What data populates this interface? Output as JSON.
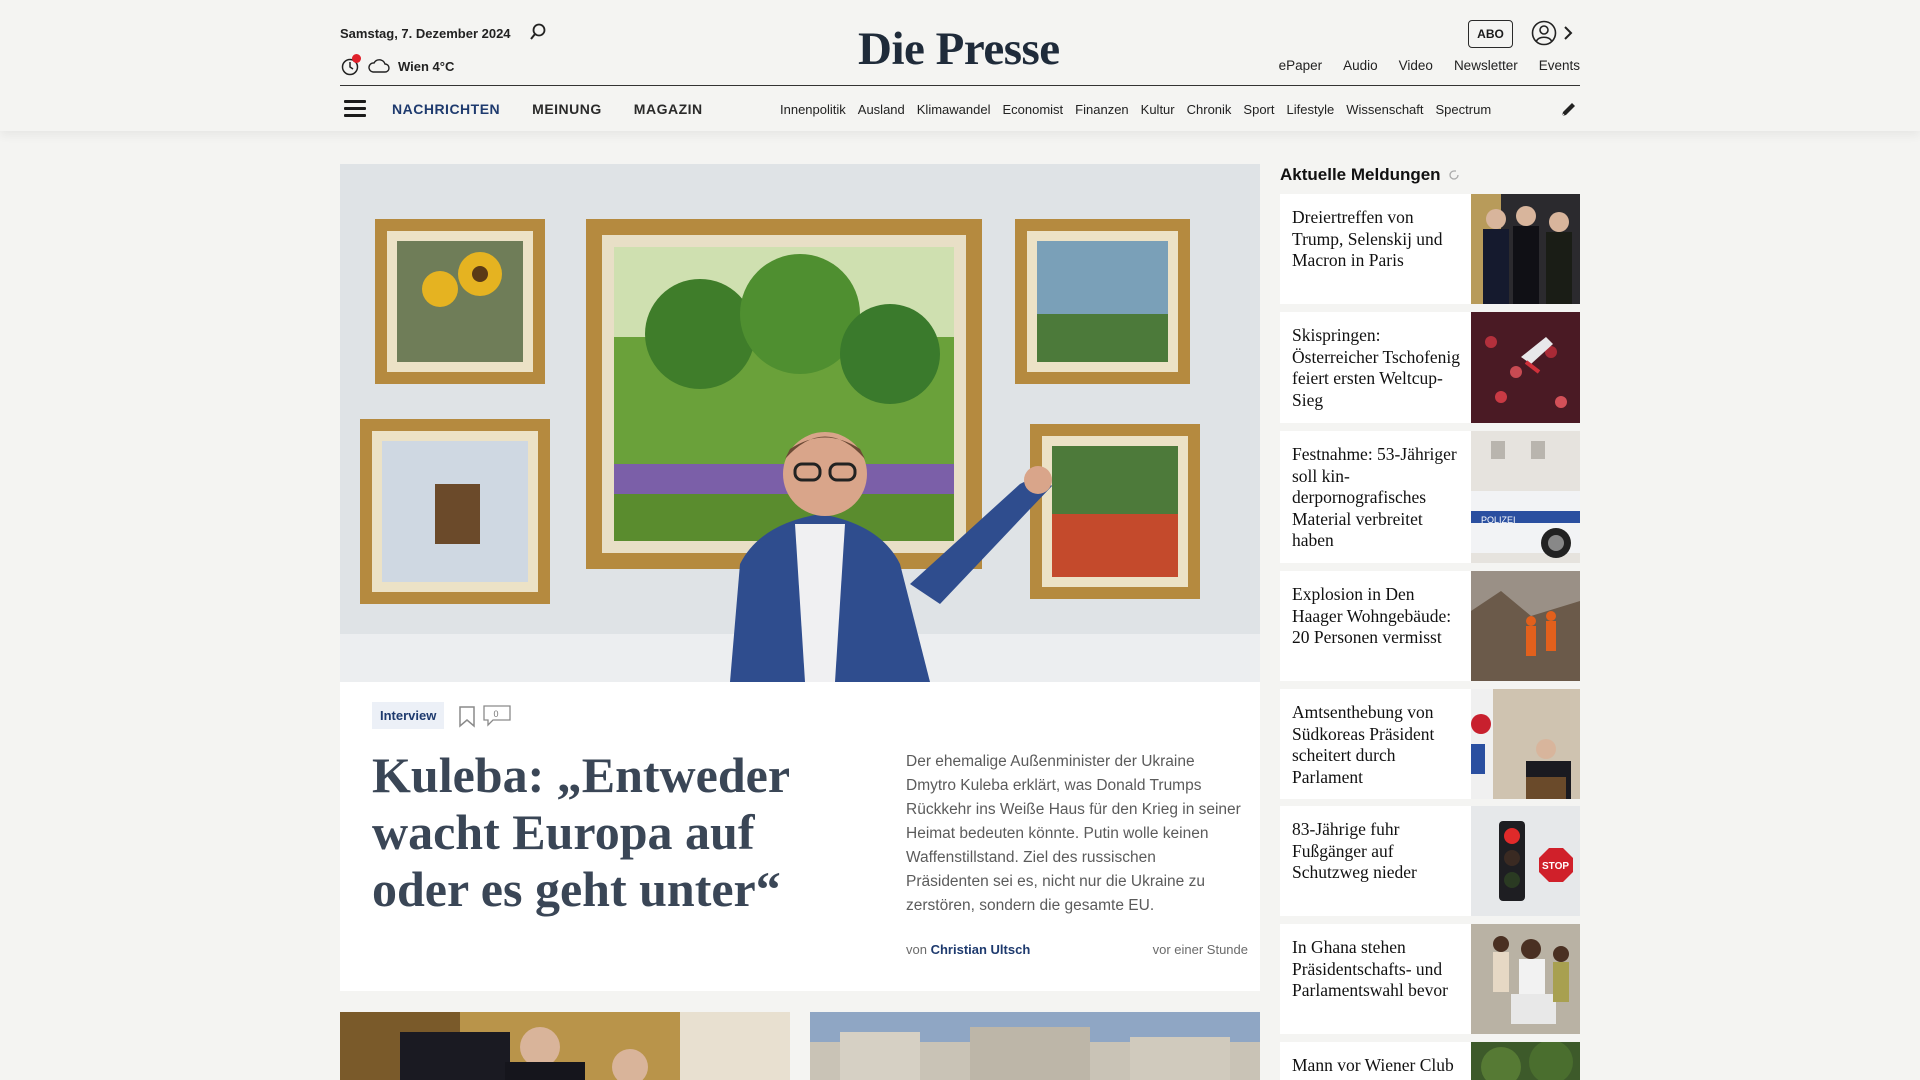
{
  "header": {
    "date": "Samstag, 7. Dezember 2024",
    "weather": "Wien 4°C",
    "logo": "Die Presse",
    "abo_label": "ABO",
    "top_links": [
      "ePaper",
      "Audio",
      "Video",
      "Newsletter",
      "Events"
    ],
    "main_nav": [
      "NACHRICHTEN",
      "MEINUNG",
      "MAGAZIN"
    ],
    "sub_nav": [
      "Innenpolitik",
      "Ausland",
      "Klimawandel",
      "Economist",
      "Finanzen",
      "Kultur",
      "Chronik",
      "Sport",
      "Lifestyle",
      "Wissenschaft",
      "Spectrum"
    ]
  },
  "hero": {
    "tag": "Interview",
    "comment_count": "0",
    "headline": "Kuleba: „Entweder wacht Europa auf oder es geht unter“",
    "teaser": "Der ehemalige Außenminister der Ukraine Dmytro Kuleba erklärt, was Donald Trumps Rückkehr ins Weiße Haus für den Krieg in seiner Heimat bedeuten könnte. Putin wolle keinen Waffenstillstand. Ziel des russischen Präsidenten sei es, nicht nur die Ukraine zu zerstören, sondern die gesamte EU.",
    "byline_prefix": "von",
    "author": "Christian Ultsch",
    "time_ago": "vor einer Stunde"
  },
  "sidebar": {
    "title": "Aktuelle Meldungen",
    "items": [
      {
        "title": "Dreiertreffen von Trump, Selenskij und Macron in Paris"
      },
      {
        "title": "Skispringen: Österreicher Tschofenig feiert ersten Weltcup-Sieg"
      },
      {
        "title": "Festnahme: 53-Jähriger soll kin­derpornografisches Material verbreitet haben"
      },
      {
        "title": "Explosion in Den Haager Wohngebäude: 20 Personen vermisst"
      },
      {
        "title": "Amtsenthebung von Südkoreas Präsident scheitert durch Parlament"
      },
      {
        "title": "83-Jährige fuhr Fußgänger auf Schutzweg nieder"
      },
      {
        "title": "In Ghana stehen Präsidentschafts- und Parlamentswahl bevor"
      },
      {
        "title": "Mann vor Wiener Club lebensgefährlich verletzt"
      }
    ]
  },
  "colors": {
    "accent": "#1e3a6e",
    "breaking_dot": "#e0202a",
    "page_bg": "#f4f4f2"
  }
}
